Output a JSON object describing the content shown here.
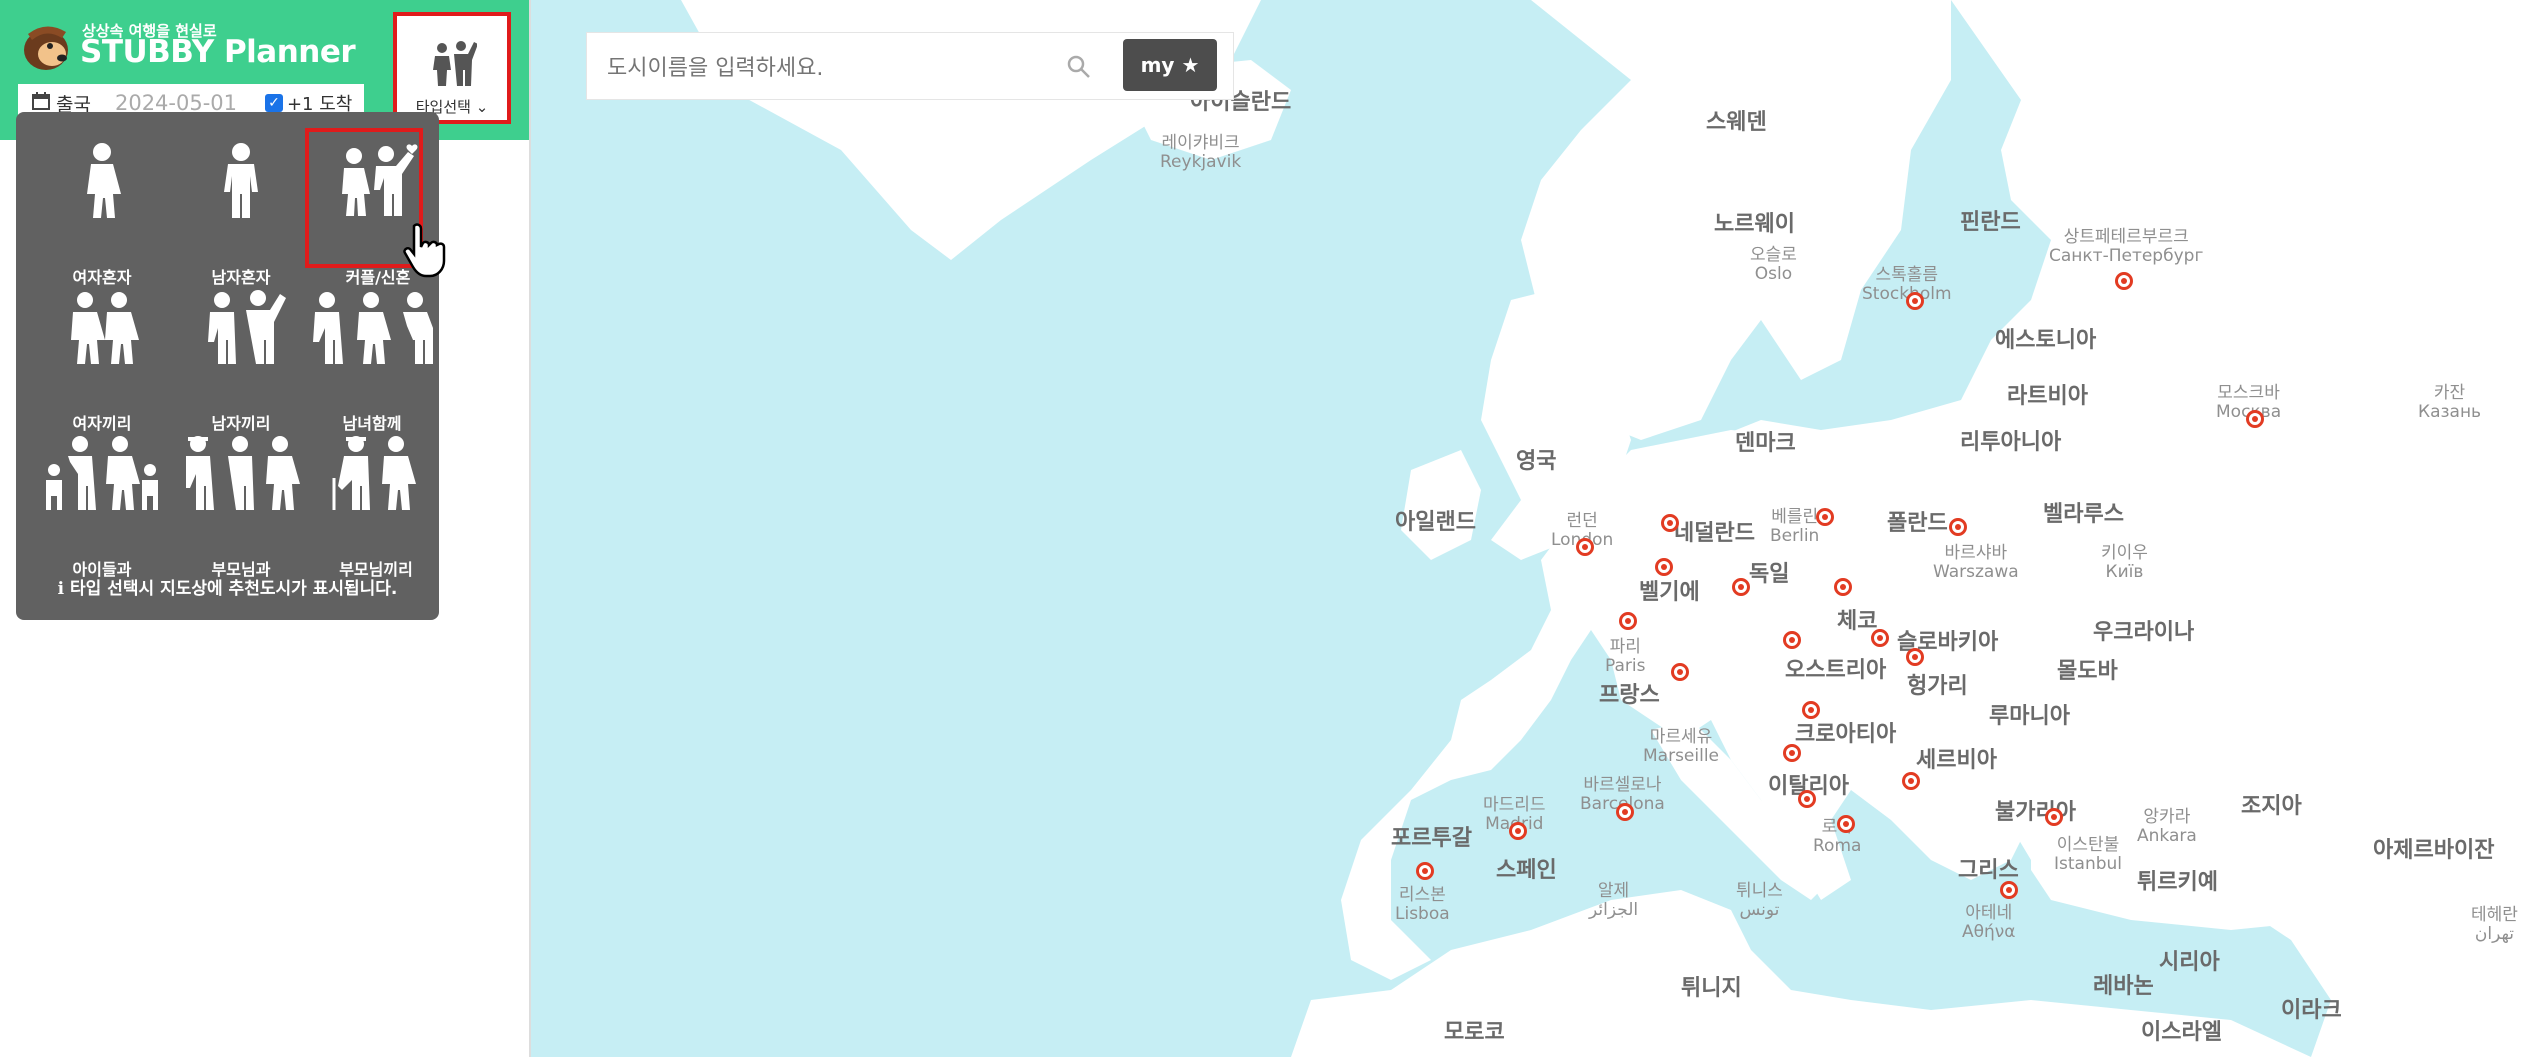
{
  "header": {
    "slogan": "상상속 여행을 현실로",
    "brand": "STUBBY Planner",
    "date_label": "출국",
    "date_value": "2024-05-01",
    "plus_arrival": "+1 도착",
    "type_button_label": "타입선택"
  },
  "type_panel": {
    "options": [
      {
        "label": "여자혼자"
      },
      {
        "label": "남자혼자"
      },
      {
        "label": "커플/신혼"
      },
      {
        "label": "여자끼리"
      },
      {
        "label": "남자끼리"
      },
      {
        "label": "남녀함께"
      },
      {
        "label": "아이들과"
      },
      {
        "label": "부모님과"
      },
      {
        "label": "부모님끼리"
      }
    ],
    "selected": "커플/신혼",
    "note": "타입 선택시 지도상에 추천도시가 표시됩니다."
  },
  "search": {
    "placeholder": "도시이름을 입력하세요.",
    "my_label": "my"
  },
  "map": {
    "countries": [
      "아이슬란드",
      "스웨덴",
      "노르웨이",
      "핀란드",
      "에스토니아",
      "라트비아",
      "리투아니아",
      "덴마크",
      "영국",
      "아일랜드",
      "벨라루스",
      "네덜란드",
      "폴란드",
      "독일",
      "벨기에",
      "체코",
      "슬로바키아",
      "우크라이나",
      "오스트리아",
      "프랑스",
      "헝가리",
      "몰도바",
      "루마니아",
      "크로아티아",
      "세르비아",
      "이탈리아",
      "불가리아",
      "조지아",
      "포르투갈",
      "스페인",
      "아제르바이잔",
      "그리스",
      "튀르키예",
      "튀니지",
      "시리아",
      "레바논",
      "이라크",
      "모로코",
      "이스라엘"
    ],
    "cities": [
      {
        "ko": "레이캬비크",
        "en": "Reykjavik"
      },
      {
        "ko": "오슬로",
        "en": "Oslo"
      },
      {
        "ko": "스톡홀름",
        "en": "Stockholm"
      },
      {
        "ko": "상트페테르부르크",
        "en": "Санкт-Петербург"
      },
      {
        "ko": "모스크바",
        "en": "Москва"
      },
      {
        "ko": "카잔",
        "en": "Казань"
      },
      {
        "ko": "런던",
        "en": "London"
      },
      {
        "ko": "베를린",
        "en": "Berlin"
      },
      {
        "ko": "바르샤바",
        "en": "Warszawa"
      },
      {
        "ko": "키이우",
        "en": "Київ"
      },
      {
        "ko": "파리",
        "en": "Paris"
      },
      {
        "ko": "마르세유",
        "en": "Marseille"
      },
      {
        "ko": "바르셀로나",
        "en": "Barcelona"
      },
      {
        "ko": "마드리드",
        "en": "Madrid"
      },
      {
        "ko": "리스본",
        "en": "Lisboa"
      },
      {
        "ko": "로마",
        "en": "Roma"
      },
      {
        "ko": "앙카라",
        "en": "Ankara"
      },
      {
        "ko": "이스탄불",
        "en": "Istanbul"
      },
      {
        "ko": "아테네",
        "en": "Αθήνα"
      },
      {
        "ko": "알제",
        "en": "الجزائر"
      },
      {
        "ko": "튀니스",
        "en": "تونس"
      },
      {
        "ko": "테헤란",
        "en": "تهران"
      }
    ]
  }
}
